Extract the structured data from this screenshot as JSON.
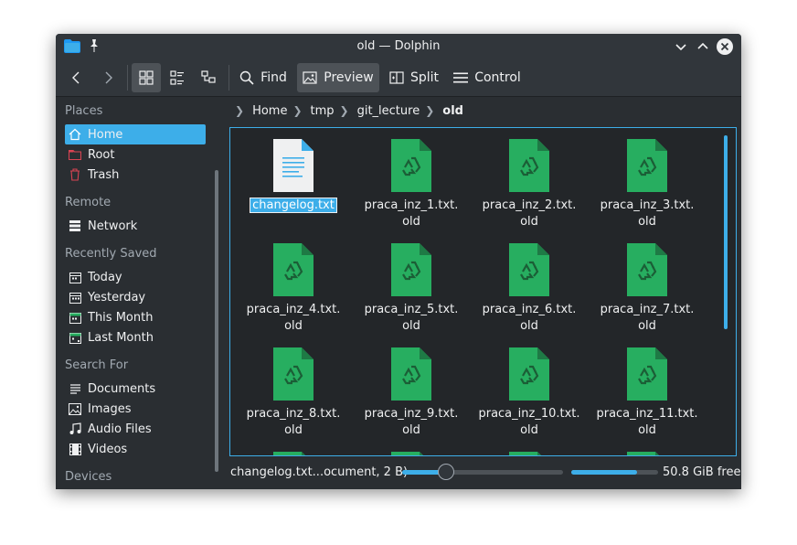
{
  "window": {
    "title": "old — Dolphin"
  },
  "toolbar": {
    "find_label": "Find",
    "preview_label": "Preview",
    "split_label": "Split",
    "control_label": "Control"
  },
  "sidebar": {
    "sections": [
      {
        "label": "Places",
        "items": [
          {
            "label": "Home",
            "icon": "home-icon",
            "selected": true
          },
          {
            "label": "Root",
            "icon": "folder-red-icon"
          },
          {
            "label": "Trash",
            "icon": "trash-icon"
          }
        ]
      },
      {
        "label": "Remote",
        "items": [
          {
            "label": "Network",
            "icon": "network-icon"
          }
        ]
      },
      {
        "label": "Recently Saved",
        "items": [
          {
            "label": "Today",
            "icon": "calendar-icon"
          },
          {
            "label": "Yesterday",
            "icon": "calendar-icon"
          },
          {
            "label": "This Month",
            "icon": "calendar-icon"
          },
          {
            "label": "Last Month",
            "icon": "calendar-icon"
          }
        ]
      },
      {
        "label": "Search For",
        "items": [
          {
            "label": "Documents",
            "icon": "documents-icon"
          },
          {
            "label": "Images",
            "icon": "images-icon"
          },
          {
            "label": "Audio Files",
            "icon": "audio-icon"
          },
          {
            "label": "Videos",
            "icon": "videos-icon"
          }
        ]
      },
      {
        "label": "Devices",
        "items": []
      }
    ]
  },
  "breadcrumb": [
    "Home",
    "tmp",
    "git_lecture",
    "old"
  ],
  "files": [
    {
      "name": "changelog.txt",
      "type": "text",
      "selected": true
    },
    {
      "name": "praca_inz_1.txt.\nold",
      "type": "backup"
    },
    {
      "name": "praca_inz_2.txt.\nold",
      "type": "backup"
    },
    {
      "name": "praca_inz_3.txt.\nold",
      "type": "backup"
    },
    {
      "name": "praca_inz_4.txt.\nold",
      "type": "backup"
    },
    {
      "name": "praca_inz_5.txt.\nold",
      "type": "backup"
    },
    {
      "name": "praca_inz_6.txt.\nold",
      "type": "backup"
    },
    {
      "name": "praca_inz_7.txt.\nold",
      "type": "backup"
    },
    {
      "name": "praca_inz_8.txt.\nold",
      "type": "backup"
    },
    {
      "name": "praca_inz_9.txt.\nold",
      "type": "backup"
    },
    {
      "name": "praca_inz_10.txt.\nold",
      "type": "backup"
    },
    {
      "name": "praca_inz_11.txt.\nold",
      "type": "backup"
    }
  ],
  "status": {
    "text": "changelog.txt...ocument, 2 B)",
    "zoom_fraction": 0.27,
    "free_space_text": "50.8 GiB free",
    "used_fraction": 0.76
  },
  "colors": {
    "accent": "#3daee9",
    "backup_icon": "#27ae60",
    "window_bg": "#2a2e32",
    "view_bg": "#232629"
  }
}
